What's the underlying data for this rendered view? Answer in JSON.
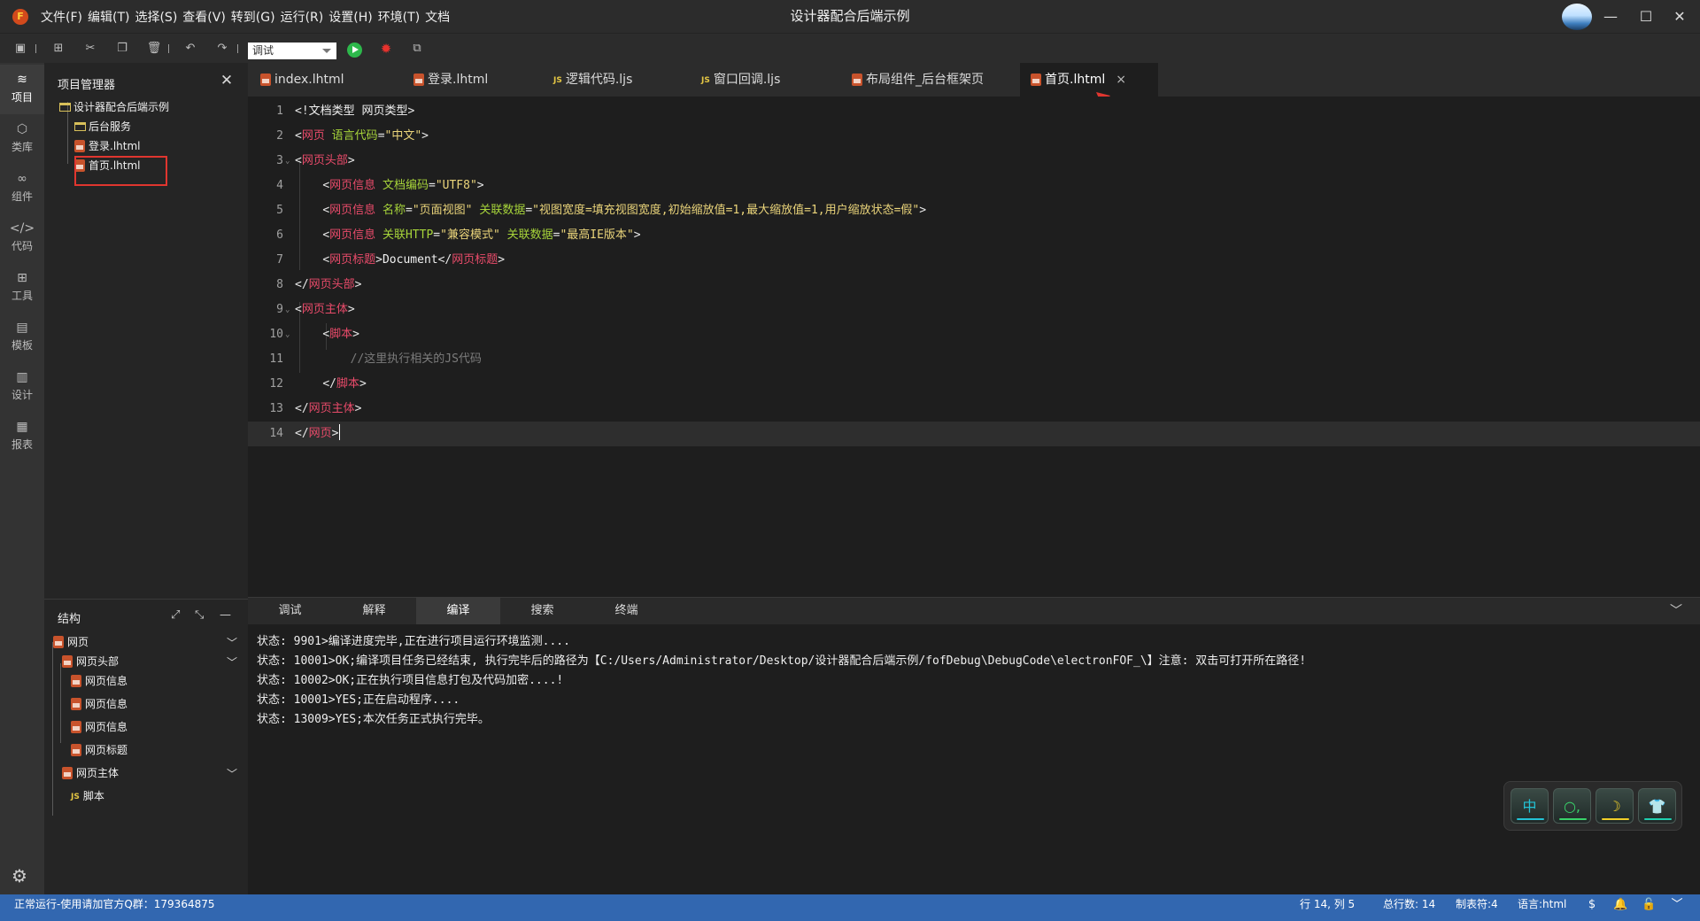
{
  "titlebar": {
    "logo_letter": "F",
    "menu": [
      "文件(F)",
      "编辑(T)",
      "选择(S)",
      "查看(V)",
      "转到(G)",
      "运行(R)",
      "设置(H)",
      "环境(T)",
      "文档"
    ],
    "title": "设计器配合后端示例"
  },
  "toolbar": {
    "mode_value": "调试",
    "icons": [
      "save-icon",
      "new-file-icon",
      "cut-icon",
      "copy-icon",
      "delete-icon",
      "undo-icon",
      "redo-icon",
      "run-icon",
      "debug-icon",
      "preview-icon"
    ]
  },
  "activity": [
    {
      "label": "项目",
      "icon": "layers-icon"
    },
    {
      "label": "类库",
      "icon": "cube-icon"
    },
    {
      "label": "组件",
      "icon": "link-icon"
    },
    {
      "label": "代码",
      "icon": "code-icon"
    },
    {
      "label": "工具",
      "icon": "tools-icon"
    },
    {
      "label": "模板",
      "icon": "template-icon"
    },
    {
      "label": "设计",
      "icon": "design-icon"
    },
    {
      "label": "报表",
      "icon": "report-icon"
    }
  ],
  "project_panel": {
    "title": "项目管理器",
    "root": "设计器配合后端示例",
    "items": [
      "后台服务",
      "登录.lhtml",
      "首页.lhtml"
    ]
  },
  "structure_panel": {
    "title": "结构",
    "nodes": [
      {
        "label": "网页"
      },
      {
        "label": "网页头部"
      },
      {
        "label": "网页信息"
      },
      {
        "label": "网页信息"
      },
      {
        "label": "网页信息"
      },
      {
        "label": "网页标题"
      },
      {
        "label": "网页主体"
      },
      {
        "label": "脚本",
        "badge": "JS"
      }
    ]
  },
  "tabs": [
    {
      "label": "index.lhtml"
    },
    {
      "label": "登录.lhtml"
    },
    {
      "label": "逻辑代码.ljs",
      "badge": "JS"
    },
    {
      "label": "窗口回调.ljs",
      "badge": "JS"
    },
    {
      "label": "布局组件_后台框架页"
    },
    {
      "label": "首页.lhtml",
      "active": true
    }
  ],
  "editor": {
    "lines": [
      [
        [
          "br",
          "<!"
        ],
        [
          "txt",
          "文档类型 网页类型"
        ],
        [
          "br",
          ">"
        ]
      ],
      [
        [
          "br",
          "<"
        ],
        [
          "tag",
          "网页"
        ],
        [
          "txt",
          " "
        ],
        [
          "attr",
          "语言代码"
        ],
        [
          "br",
          "="
        ],
        [
          "str",
          "\"中文\""
        ],
        [
          "br",
          ">"
        ]
      ],
      [
        [
          "br",
          "<"
        ],
        [
          "tag",
          "网页头部"
        ],
        [
          "br",
          ">"
        ]
      ],
      [
        [
          "txt",
          "    "
        ],
        [
          "br",
          "<"
        ],
        [
          "tag",
          "网页信息"
        ],
        [
          "txt",
          " "
        ],
        [
          "attr",
          "文档编码"
        ],
        [
          "br",
          "="
        ],
        [
          "str",
          "\"UTF8\""
        ],
        [
          "br",
          ">"
        ]
      ],
      [
        [
          "txt",
          "    "
        ],
        [
          "br",
          "<"
        ],
        [
          "tag",
          "网页信息"
        ],
        [
          "txt",
          " "
        ],
        [
          "attr",
          "名称"
        ],
        [
          "br",
          "="
        ],
        [
          "str",
          "\"页面视图\""
        ],
        [
          "txt",
          " "
        ],
        [
          "attr",
          "关联数据"
        ],
        [
          "br",
          "="
        ],
        [
          "str",
          "\"视图宽度=填充视图宽度,初始缩放值=1,最大缩放值=1,用户缩放状态=假\""
        ],
        [
          "br",
          ">"
        ]
      ],
      [
        [
          "txt",
          "    "
        ],
        [
          "br",
          "<"
        ],
        [
          "tag",
          "网页信息"
        ],
        [
          "txt",
          " "
        ],
        [
          "attr",
          "关联HTTP"
        ],
        [
          "br",
          "="
        ],
        [
          "str",
          "\"兼容模式\""
        ],
        [
          "txt",
          " "
        ],
        [
          "attr",
          "关联数据"
        ],
        [
          "br",
          "="
        ],
        [
          "str",
          "\"最高IE版本\""
        ],
        [
          "br",
          ">"
        ]
      ],
      [
        [
          "txt",
          "    "
        ],
        [
          "br",
          "<"
        ],
        [
          "tag",
          "网页标题"
        ],
        [
          "br",
          ">"
        ],
        [
          "txt",
          "Document"
        ],
        [
          "br",
          "</"
        ],
        [
          "tag",
          "网页标题"
        ],
        [
          "br",
          ">"
        ]
      ],
      [
        [
          "br",
          "</"
        ],
        [
          "tag",
          "网页头部"
        ],
        [
          "br",
          ">"
        ]
      ],
      [
        [
          "br",
          "<"
        ],
        [
          "tag",
          "网页主体"
        ],
        [
          "br",
          ">"
        ]
      ],
      [
        [
          "txt",
          "    "
        ],
        [
          "br",
          "<"
        ],
        [
          "tag",
          "脚本"
        ],
        [
          "br",
          ">"
        ]
      ],
      [
        [
          "txt",
          "        "
        ],
        [
          "cm",
          "//这里执行相关的JS代码"
        ]
      ],
      [
        [
          "txt",
          "    "
        ],
        [
          "br",
          "</"
        ],
        [
          "tag",
          "脚本"
        ],
        [
          "br",
          ">"
        ]
      ],
      [
        [
          "br",
          "</"
        ],
        [
          "tag",
          "网页主体"
        ],
        [
          "br",
          ">"
        ]
      ],
      [
        [
          "br",
          "</"
        ],
        [
          "tag",
          "网页"
        ],
        [
          "br",
          ">"
        ]
      ]
    ],
    "line_numbers": [
      "1",
      "2",
      "3",
      "4",
      "5",
      "6",
      "7",
      "8",
      "9",
      "10",
      "11",
      "12",
      "13",
      "14"
    ],
    "foldable_lines": [
      3,
      9,
      10
    ],
    "current_line": 14
  },
  "bottom_panel": {
    "tabs": [
      "调试",
      "解释",
      "编译",
      "搜索",
      "终端"
    ],
    "active_tab": "编译",
    "logs": [
      "状态: 9901>编译进度完毕,正在进行项目运行环境监测....",
      "状态: 10001>OK;编译项目任务已经结束, 执行完毕后的路径为【C:/Users/Administrator/Desktop/设计器配合后端示例/fofDebug\\DebugCode\\electronFOF_\\】注意: 双击可打开所在路径!",
      "状态: 10002>OK;正在执行项目信息打包及代码加密....!",
      "状态: 10001>YES;正在启动程序....",
      "状态: 13009>YES;本次任务正式执行完毕。"
    ]
  },
  "float_widget": {
    "buttons": [
      {
        "label": "中",
        "color": "#23c3d6"
      },
      {
        "label": "○,",
        "color": "#39d36a"
      },
      {
        "label": "☽",
        "color": "#f0cf28"
      },
      {
        "label": "👕",
        "color": "#1fd0b0"
      }
    ]
  },
  "statusbar": {
    "left": "正常运行-使用请加官方Q群：179364875",
    "position": "行 14, 列 5",
    "total_lines": "总行数: 14",
    "tab_size": "制表符:4",
    "language": "语言:html",
    "color": "#3267b0"
  }
}
